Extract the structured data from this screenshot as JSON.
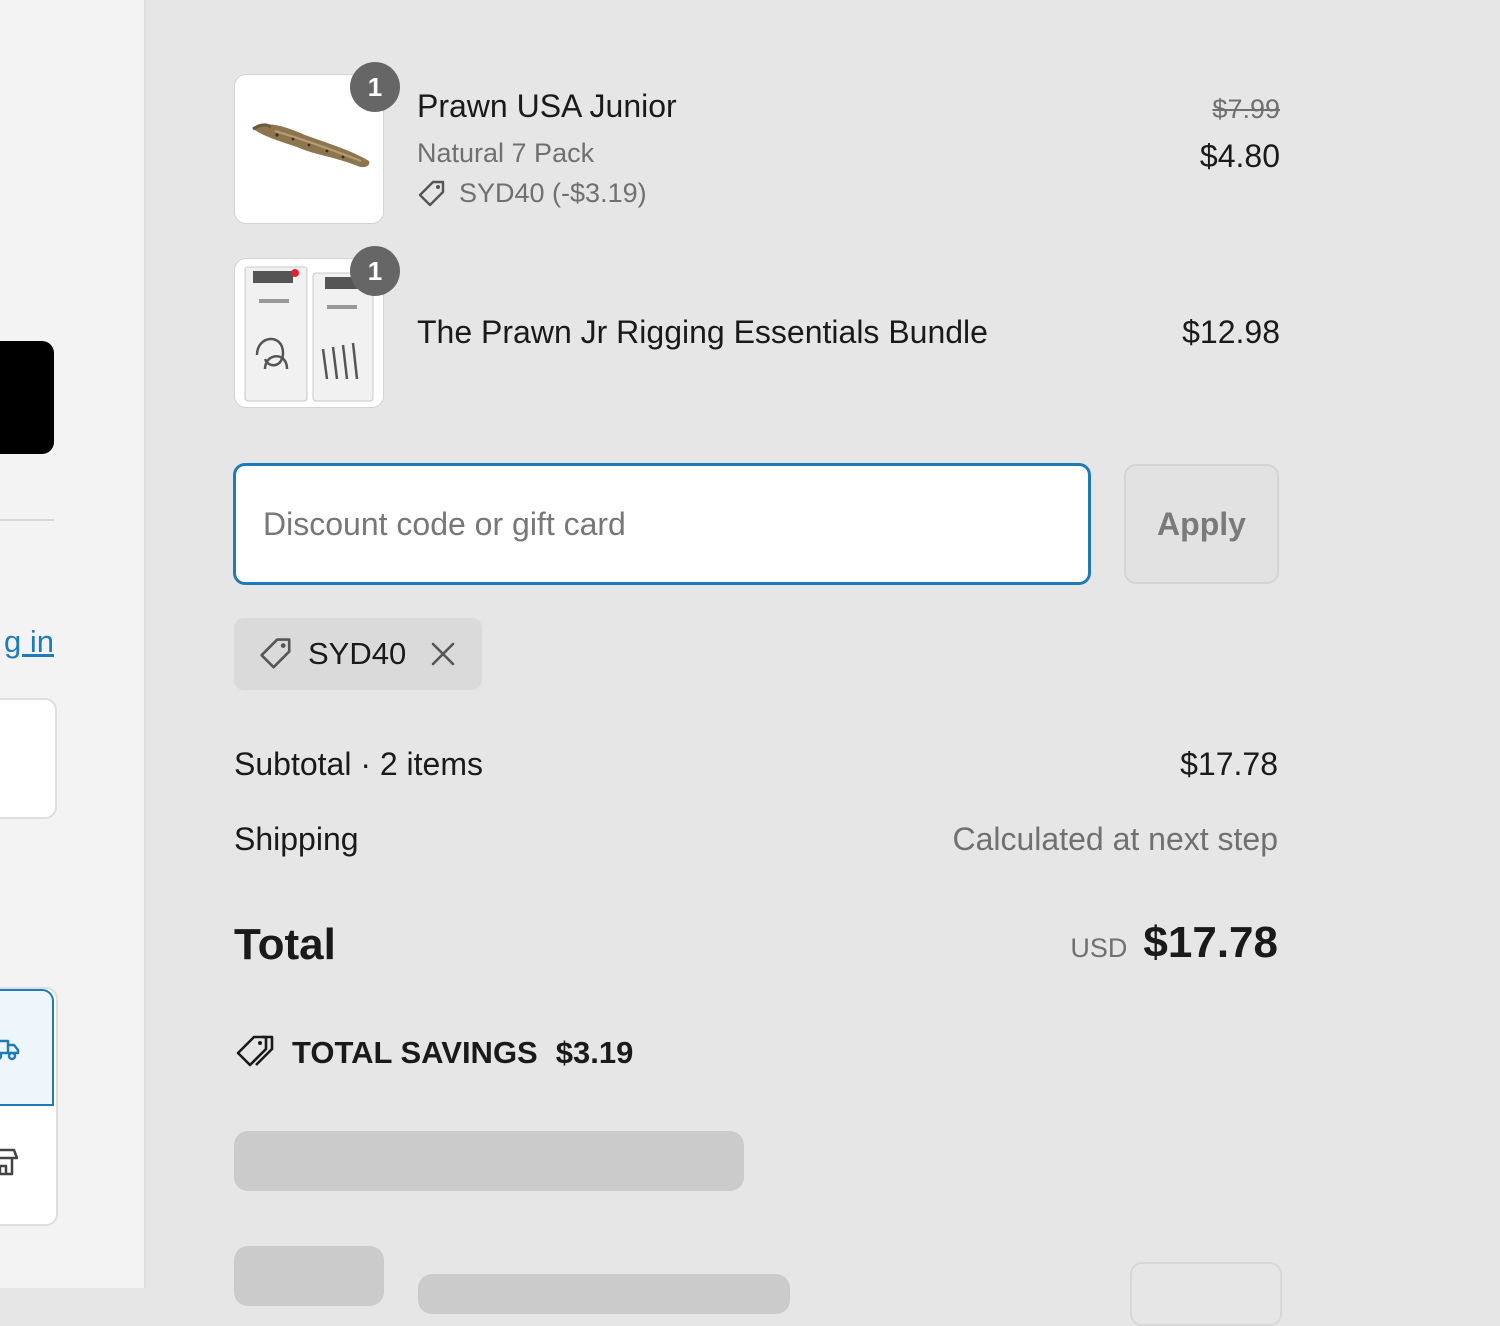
{
  "left_panel": {
    "login_link": "g in"
  },
  "order_summary": {
    "line_items": [
      {
        "quantity": "1",
        "title": "Prawn USA Junior",
        "variant": "Natural 7 Pack",
        "discount": "SYD40 (-$3.19)",
        "compare_price": "$7.99",
        "price": "$4.80"
      },
      {
        "quantity": "1",
        "title": "The Prawn Jr Rigging Essentials Bundle",
        "price": "$12.98"
      }
    ],
    "discount": {
      "placeholder": "Discount code or gift card",
      "apply_label": "Apply",
      "applied_code": "SYD40"
    },
    "subtotal_label": "Subtotal · 2 items",
    "subtotal_value": "$17.78",
    "shipping_label": "Shipping",
    "shipping_value": "Calculated at next step",
    "total_label": "Total",
    "currency": "USD",
    "total_value": "$17.78",
    "savings_label": "TOTAL SAVINGS",
    "savings_value": "$3.19"
  },
  "colors": {
    "accent": "#1f7bb8",
    "background": "#e6e6e6",
    "muted_text": "#707070"
  },
  "icons": [
    "tag-icon",
    "close-icon",
    "truck-icon",
    "store-icon",
    "badge-icon"
  ]
}
